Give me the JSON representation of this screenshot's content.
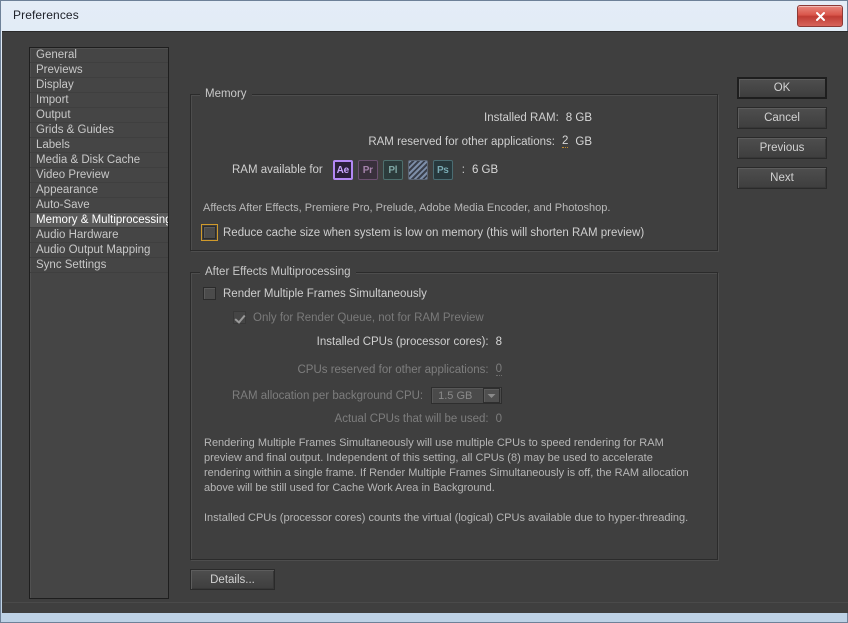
{
  "window": {
    "title": "Preferences",
    "close_icon": "close-icon"
  },
  "sidebar": {
    "items": [
      {
        "label": "General",
        "selected": false
      },
      {
        "label": "Previews",
        "selected": false
      },
      {
        "label": "Display",
        "selected": false
      },
      {
        "label": "Import",
        "selected": false
      },
      {
        "label": "Output",
        "selected": false
      },
      {
        "label": "Grids & Guides",
        "selected": false
      },
      {
        "label": "Labels",
        "selected": false
      },
      {
        "label": "Media & Disk Cache",
        "selected": false
      },
      {
        "label": "Video Preview",
        "selected": false
      },
      {
        "label": "Appearance",
        "selected": false
      },
      {
        "label": "Auto-Save",
        "selected": false
      },
      {
        "label": "Memory & Multiprocessing",
        "selected": true
      },
      {
        "label": "Audio Hardware",
        "selected": false
      },
      {
        "label": "Audio Output Mapping",
        "selected": false
      },
      {
        "label": "Sync Settings",
        "selected": false
      }
    ]
  },
  "memory": {
    "group_title": "Memory",
    "installed_ram_label": "Installed RAM:",
    "installed_ram_value": "8 GB",
    "reserved_ram_label": "RAM reserved for other applications:",
    "reserved_ram_value": "2",
    "reserved_ram_unit": "GB",
    "available_ram_label": "RAM available for",
    "available_ram_colon": ":",
    "available_ram_value": "6 GB",
    "app_icons": [
      {
        "name": "after-effects-icon",
        "text": "Ae",
        "style": "ae"
      },
      {
        "name": "premiere-pro-icon",
        "text": "Pr",
        "style": "pr"
      },
      {
        "name": "prelude-icon",
        "text": "Pl",
        "style": "pl"
      },
      {
        "name": "adobe-media-encoder-icon",
        "text": "",
        "style": "ame"
      },
      {
        "name": "photoshop-icon",
        "text": "Ps",
        "style": "ps"
      }
    ],
    "note": "Affects After Effects, Premiere Pro, Prelude, Adobe Media Encoder, and Photoshop.",
    "reduce_cache_label": "Reduce cache size when system is low on memory (this will shorten RAM preview)",
    "reduce_cache_checked": false,
    "reduce_cache_focused": true
  },
  "multiprocessing": {
    "group_title": "After Effects Multiprocessing",
    "render_mfs_label": "Render Multiple Frames Simultaneously",
    "render_mfs_checked": false,
    "render_queue_label": "Only for Render Queue, not for RAM Preview",
    "render_queue_checked": true,
    "render_queue_disabled": true,
    "installed_cpus_label": "Installed CPUs (processor cores):",
    "installed_cpus_value": "8",
    "reserved_cpus_label": "CPUs reserved for other applications:",
    "reserved_cpus_value": "0",
    "ram_alloc_label": "RAM allocation per background CPU:",
    "ram_alloc_value": "1.5 GB",
    "actual_cpus_label": "Actual CPUs that will be used:",
    "actual_cpus_value": "0",
    "paragraph_1": "Rendering Multiple Frames Simultaneously will use multiple CPUs to speed rendering for RAM preview and final output. Independent of this setting, all CPUs (8) may be used to accelerate rendering within a single frame. If Render Multiple Frames Simultaneously is off, the RAM allocation above will be still used for Cache Work Area in Background.",
    "paragraph_2": "Installed CPUs (processor cores) counts the virtual (logical) CPUs available due to hyper-threading."
  },
  "buttons": {
    "ok": "OK",
    "cancel": "Cancel",
    "previous": "Previous",
    "next": "Next",
    "details": "Details..."
  },
  "colors": {
    "accent_hot_text": "#e0a63c",
    "selection": "#5a5a5a",
    "panel_bg": "#3f3f3f",
    "titlebar": "#cfdeee",
    "close_button": "#c03c33",
    "ae_purple": "#b388f5"
  }
}
